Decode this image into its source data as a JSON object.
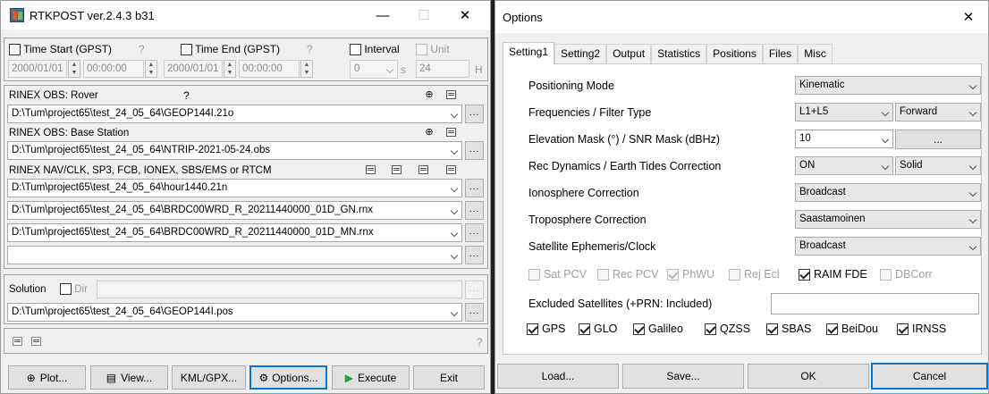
{
  "rtk": {
    "title": "RTKPOST ver.2.4.3 b31",
    "time_start_label": "Time Start (GPST)",
    "time_end_label": "Time End (GPST)",
    "help": "?",
    "interval_label": "Interval",
    "unit_label": "Unit",
    "start_date": "2000/01/01",
    "start_time": "00:00:00",
    "end_date": "2000/01/01",
    "end_time": "00:00:00",
    "interval_value": "0",
    "interval_unit": "s",
    "unit_value": "24",
    "unit_suffix": "H",
    "rover_label": "RINEX OBS: Rover",
    "rover_file": "D:\\Tum\\project65\\test_24_05_64\\GEOP144I.21o",
    "base_label": "RINEX OBS: Base Station",
    "base_file": "D:\\Tum\\project65\\test_24_05_64\\NTRIP-2021-05-24.obs",
    "nav_label": "RINEX NAV/CLK, SP3, FCB, IONEX, SBS/EMS  or RTCM",
    "nav_files": [
      "D:\\Tum\\project65\\test_24_05_64\\hour1440.21n",
      "D:\\Tum\\project65\\test_24_05_64\\BRDC00WRD_R_20211440000_01D_GN.rnx",
      "D:\\Tum\\project65\\test_24_05_64\\BRDC00WRD_R_20211440000_01D_MN.rnx",
      ""
    ],
    "solution_label": "Solution",
    "dir_label": "Dir",
    "solution_file": "D:\\Tum\\project65\\test_24_05_64\\GEOP144I.pos",
    "dots": "...",
    "buttons": {
      "plot": "Plot...",
      "view": "View...",
      "kml": "KML/GPX...",
      "options": "Options...",
      "execute": "Execute",
      "exit": "Exit"
    }
  },
  "options": {
    "title": "Options",
    "tabs": [
      "Setting1",
      "Setting2",
      "Output",
      "Statistics",
      "Positions",
      "Files",
      "Misc"
    ],
    "rows": [
      {
        "label": "Positioning Mode",
        "value": "Kinematic"
      },
      {
        "label": "Frequencies / Filter Type",
        "value": "L1+L5",
        "value2": "Forward"
      },
      {
        "label": "Elevation Mask (°) / SNR Mask (dBHz)",
        "value": "10",
        "value2": "..."
      },
      {
        "label": "Rec Dynamics / Earth Tides Correction",
        "value": "ON",
        "value2": "Solid"
      },
      {
        "label": "Ionosphere Correction",
        "value": "Broadcast"
      },
      {
        "label": "Troposphere Correction",
        "value": "Saastamoinen"
      },
      {
        "label": "Satellite Ephemeris/Clock",
        "value": "Broadcast"
      }
    ],
    "flags": [
      {
        "label": "Sat PCV",
        "checked": false,
        "enabled": false
      },
      {
        "label": "Rec PCV",
        "checked": false,
        "enabled": false
      },
      {
        "label": "PhWU",
        "checked": true,
        "enabled": false
      },
      {
        "label": "Rej Ecl",
        "checked": false,
        "enabled": false
      },
      {
        "label": "RAIM FDE",
        "checked": true,
        "enabled": true
      },
      {
        "label": "DBCorr",
        "checked": false,
        "enabled": false
      }
    ],
    "excluded_label": "Excluded Satellites (+PRN: Included)",
    "excluded_value": "",
    "systems": [
      {
        "label": "GPS",
        "checked": true
      },
      {
        "label": "GLO",
        "checked": true
      },
      {
        "label": "Galileo",
        "checked": true
      },
      {
        "label": "QZSS",
        "checked": true
      },
      {
        "label": "SBAS",
        "checked": true
      },
      {
        "label": "BeiDou",
        "checked": true
      },
      {
        "label": "IRNSS",
        "checked": true
      }
    ],
    "buttons": {
      "load": "Load...",
      "save": "Save...",
      "ok": "OK",
      "cancel": "Cancel"
    }
  }
}
